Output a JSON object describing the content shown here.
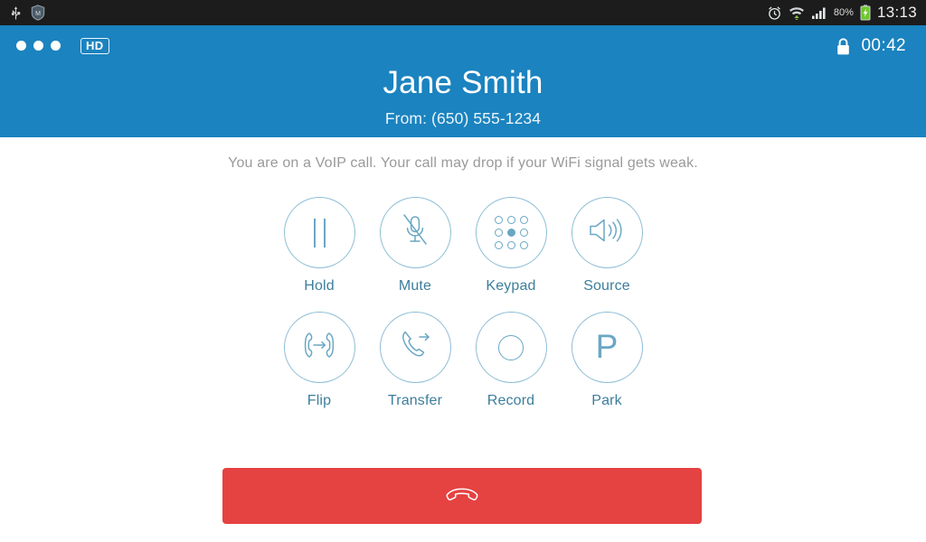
{
  "status_bar": {
    "left_icons": [
      {
        "name": "usb-icon",
        "label": "USB"
      },
      {
        "name": "security-shield-icon",
        "label": "Security"
      }
    ],
    "right_icons": [
      {
        "name": "alarm-clock-icon",
        "label": "Alarm"
      },
      {
        "name": "wifi-icon",
        "label": "WiFi"
      },
      {
        "name": "signal-bars-icon",
        "label": "Signal"
      }
    ],
    "battery_percent": "80%",
    "battery_icon": "battery-charging-icon",
    "time": "13:13"
  },
  "header": {
    "menu_icon": "three-dots-icon",
    "hd_badge": "HD",
    "lock_icon": "lock-icon",
    "call_timer": "00:42",
    "caller_name": "Jane Smith",
    "caller_from": "From: (650) 555-1234",
    "background_color": "#1b83bf"
  },
  "main": {
    "notice": "You are on a VoIP call. Your call may drop if your WiFi signal gets weak.",
    "actions": [
      {
        "label": "Hold",
        "icon": "pause-icon"
      },
      {
        "label": "Mute",
        "icon": "microphone-muted-icon"
      },
      {
        "label": "Keypad",
        "icon": "keypad-icon"
      },
      {
        "label": "Source",
        "icon": "speaker-icon"
      },
      {
        "label": "Flip",
        "icon": "flip-call-icon"
      },
      {
        "label": "Transfer",
        "icon": "transfer-call-icon"
      },
      {
        "label": "Record",
        "icon": "record-icon"
      },
      {
        "label": "Park",
        "icon": "park-icon"
      }
    ],
    "accent_color": "#3d7e9c",
    "circle_stroke_color": "#8fbed6"
  },
  "hangup_button": {
    "icon": "hangup-phone-icon",
    "label": "",
    "color": "#e54242"
  }
}
